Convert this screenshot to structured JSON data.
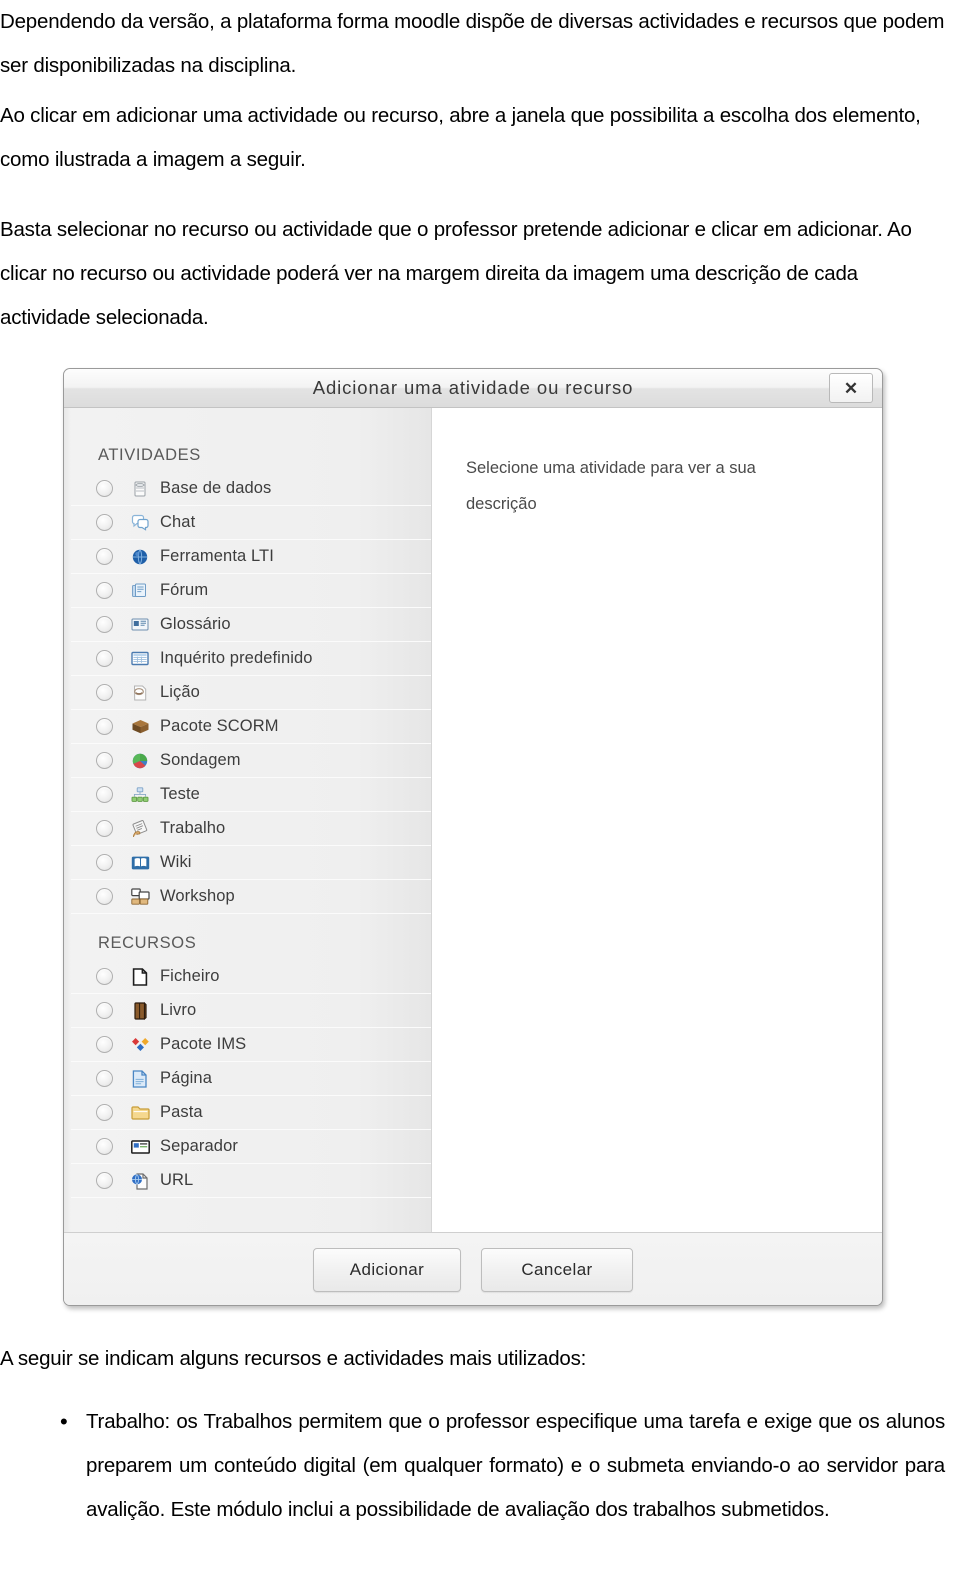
{
  "document": {
    "paragraphs": [
      "Dependendo da versão, a plataforma forma moodle dispõe de diversas actividades e recursos que podem ser disponibilizadas na disciplina.",
      "Ao clicar em adicionar uma actividade ou recurso, abre a janela que possibilita a escolha dos elemento, como ilustrada a imagem a seguir.",
      "Basta selecionar no recurso ou actividade que o professor pretende adicionar e clicar em adicionar. Ao clicar no recurso ou actividade poderá ver na margem direita da imagem uma descrição de cada actividade selecionada."
    ],
    "closing_line": "A seguir se indicam alguns recursos e actividades mais utilizados:",
    "bullet_marker": "•",
    "bullet_text": "Trabalho: os Trabalhos permitem que o professor especifique uma tarefa e exige que os alunos preparem um conteúdo digital (em qualquer formato) e o submeta enviando-o ao servidor para avalição. Este módulo inclui a possibilidade de avaliação dos trabalhos submetidos."
  },
  "dialog": {
    "title": "Adicionar uma atividade ou recurso",
    "close_label": "✕",
    "close_icon": "close-icon",
    "description_pane": {
      "placeholder_text": "Selecione uma atividade para ver a sua descrição"
    },
    "groups": [
      {
        "heading": "ATIVIDADES",
        "options": [
          {
            "label": "Base de dados",
            "icon": "database-icon",
            "selected": false
          },
          {
            "label": "Chat",
            "icon": "chat-bubbles-icon",
            "selected": false
          },
          {
            "label": "Ferramenta LTI",
            "icon": "globe-icon",
            "selected": false
          },
          {
            "label": "Fórum",
            "icon": "forum-pages-icon",
            "selected": false
          },
          {
            "label": "Glossário",
            "icon": "glossary-card-icon",
            "selected": false
          },
          {
            "label": "Inquérito predefinido",
            "icon": "survey-grid-icon",
            "selected": false
          },
          {
            "label": "Lição",
            "icon": "lesson-page-icon",
            "selected": false
          },
          {
            "label": "Pacote SCORM",
            "icon": "scorm-box-icon",
            "selected": false
          },
          {
            "label": "Sondagem",
            "icon": "poll-pie-icon",
            "selected": false
          },
          {
            "label": "Teste",
            "icon": "quiz-blocks-icon",
            "selected": false
          },
          {
            "label": "Trabalho",
            "icon": "assignment-hand-icon",
            "selected": false
          },
          {
            "label": "Wiki",
            "icon": "wiki-book-icon",
            "selected": false
          },
          {
            "label": "Workshop",
            "icon": "workshop-windows-icon",
            "selected": false
          }
        ]
      },
      {
        "heading": "RECURSOS",
        "options": [
          {
            "label": "Ficheiro",
            "icon": "file-icon",
            "selected": false
          },
          {
            "label": "Livro",
            "icon": "book-icon",
            "selected": false
          },
          {
            "label": "Pacote IMS",
            "icon": "ims-diamonds-icon",
            "selected": false
          },
          {
            "label": "Página",
            "icon": "page-blue-icon",
            "selected": false
          },
          {
            "label": "Pasta",
            "icon": "folder-icon",
            "selected": false
          },
          {
            "label": "Separador",
            "icon": "label-separator-icon",
            "selected": false
          },
          {
            "label": "URL",
            "icon": "url-globe-page-icon",
            "selected": false
          }
        ]
      }
    ],
    "footer": {
      "add_label": "Adicionar",
      "cancel_label": "Cancelar"
    }
  },
  "colors": {
    "dialog_bg": "#f4f4f4",
    "panel_bg": "#eeeeee",
    "text": "#3d3d3d",
    "title_text": "#3a3a3a",
    "border": "#9a9a9a"
  }
}
